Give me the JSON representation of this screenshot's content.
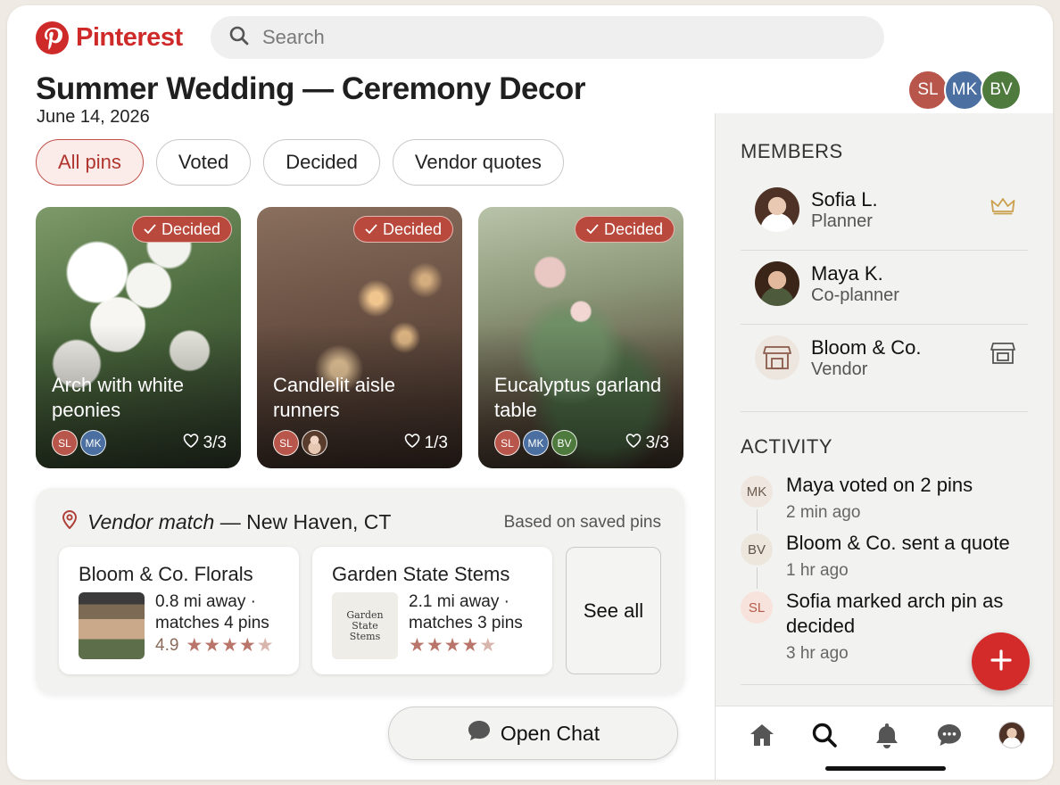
{
  "app": {
    "brand": "Pinterest"
  },
  "search": {
    "placeholder": "Search"
  },
  "board": {
    "title": "Summer Wedding — Ceremony Decor",
    "date": "June 14, 2026"
  },
  "collaborators": [
    "SL",
    "MK",
    "BV"
  ],
  "filters": [
    {
      "label": "All pins",
      "active": true
    },
    {
      "label": "Voted",
      "active": false
    },
    {
      "label": "Decided",
      "active": false
    },
    {
      "label": "Vendor quotes",
      "active": false
    }
  ],
  "pins": [
    {
      "badge": "Decided",
      "title": "Arch with white peonies",
      "voters": [
        "SL",
        "MK"
      ],
      "votes": "3/3"
    },
    {
      "badge": "Decided",
      "title": "Candlelit aisle runners",
      "voters": [
        "SL"
      ],
      "votes": "1/3"
    },
    {
      "badge": "Decided",
      "title": "Eucalyptus garland table",
      "voters": [
        "SL",
        "MK",
        "BV"
      ],
      "votes": "3/3"
    }
  ],
  "vendor_match": {
    "label": "Vendor match",
    "location": "— New Haven, CT",
    "note": "Based on saved pins",
    "vendors": [
      {
        "name": "Bloom & Co. Florals",
        "distance": "0.8 mi away ·",
        "matches": "matches 4 pins",
        "rating": "4.9",
        "stars": 4.5
      },
      {
        "name": "Garden State Stems",
        "logo_text": "Garden State Stems",
        "distance": "2.1 mi away ·",
        "matches": "matches 3 pins",
        "stars": 4.5
      }
    ],
    "see_all": "See all"
  },
  "chat": {
    "label": "Open Chat"
  },
  "members": {
    "title": "MEMBERS",
    "list": [
      {
        "name": "Sofia L.",
        "role": "Planner",
        "icon": "crown-icon"
      },
      {
        "name": "Maya K.",
        "role": "Co-planner"
      },
      {
        "name": "Bloom & Co.",
        "role": "Vendor",
        "icon": "store-icon"
      }
    ]
  },
  "activity": {
    "title": "ACTIVITY",
    "items": [
      {
        "initials": "MK",
        "text": "Maya voted on 2 pins",
        "time": "2 min ago"
      },
      {
        "initials": "BV",
        "text": "Bloom & Co. sent a quote",
        "time": "1 hr ago"
      },
      {
        "initials": "SL",
        "text": "Sofia marked arch pin as decided",
        "time": "3 hr ago"
      }
    ]
  },
  "colors": {
    "brand": "#cf2a2a",
    "accent": "#b9493c",
    "sl": "#b9564b",
    "mk": "#4a6fa0",
    "bv": "#4e7a3d"
  }
}
